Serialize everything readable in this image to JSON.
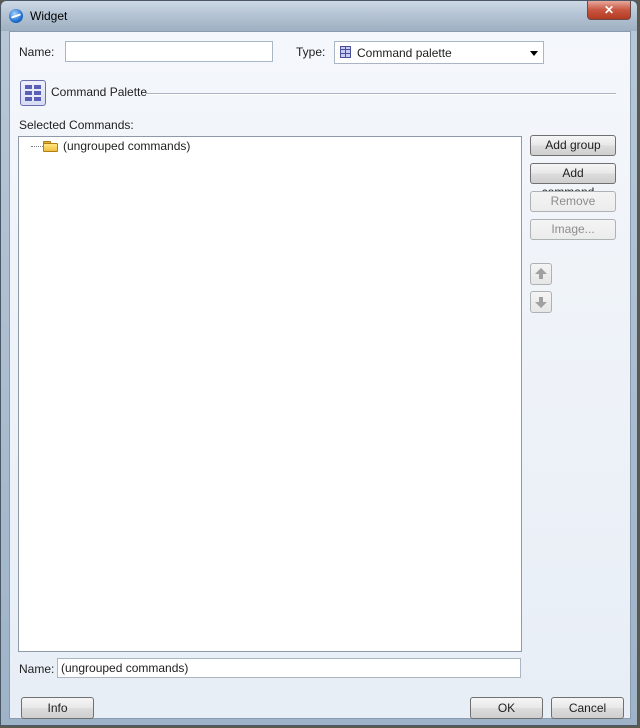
{
  "window": {
    "title": "Widget",
    "close_glyph": "✕"
  },
  "form": {
    "name_label": "Name:",
    "name_value": "",
    "type_label": "Type:",
    "type_value": "Command palette",
    "type_icon": "command-palette-icon"
  },
  "section": {
    "title": "Command Palette",
    "icon": "command-palette-icon"
  },
  "commands": {
    "label": "Selected Commands:",
    "tree": [
      {
        "label": "(ungrouped commands)",
        "icon": "folder-icon"
      }
    ]
  },
  "side_buttons": {
    "add_group": "Add group",
    "add_command": "Add command...",
    "remove": "Remove",
    "image": "Image..."
  },
  "item_name": {
    "label": "Name:",
    "value": "(ungrouped commands)"
  },
  "footer": {
    "info": "Info",
    "ok": "OK",
    "cancel": "Cancel"
  }
}
